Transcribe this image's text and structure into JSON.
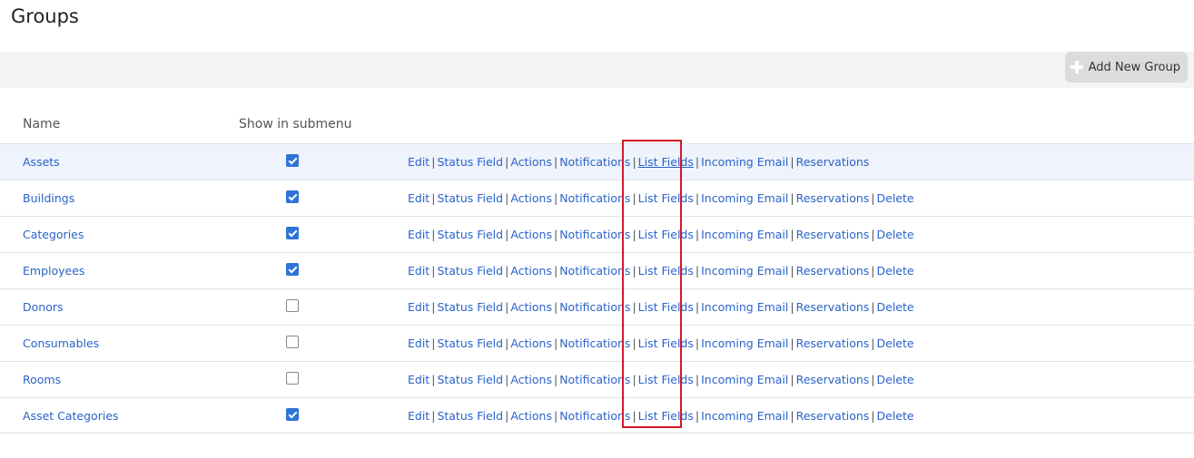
{
  "page": {
    "title": "Groups"
  },
  "toolbar": {
    "add_label": "Add New Group"
  },
  "table": {
    "headers": {
      "name": "Name",
      "show": "Show in submenu"
    },
    "separator": "|",
    "action_labels": {
      "edit": "Edit",
      "status_field": "Status Field",
      "actions": "Actions",
      "notifications": "Notifications",
      "list_fields": "List Fields",
      "incoming_email": "Incoming Email",
      "reservations": "Reservations",
      "delete": "Delete"
    },
    "rows": [
      {
        "name": "Assets",
        "show_in_submenu": true,
        "has_delete": false
      },
      {
        "name": "Buildings",
        "show_in_submenu": true,
        "has_delete": true
      },
      {
        "name": "Categories",
        "show_in_submenu": true,
        "has_delete": true
      },
      {
        "name": "Employees",
        "show_in_submenu": true,
        "has_delete": true
      },
      {
        "name": "Donors",
        "show_in_submenu": false,
        "has_delete": true
      },
      {
        "name": "Consumables",
        "show_in_submenu": false,
        "has_delete": true
      },
      {
        "name": "Rooms",
        "show_in_submenu": false,
        "has_delete": true
      },
      {
        "name": "Asset Categories",
        "show_in_submenu": true,
        "has_delete": true
      }
    ]
  },
  "colors": {
    "link": "#2a63c9",
    "checkbox": "#2f73d8",
    "highlight": "#d4182b",
    "selected_row": "#eef3fc"
  }
}
